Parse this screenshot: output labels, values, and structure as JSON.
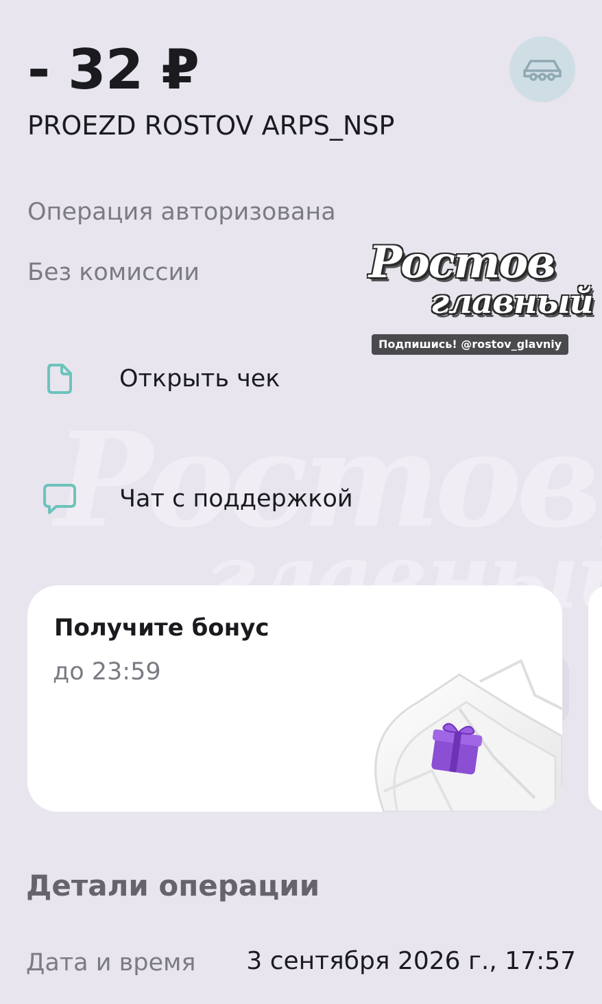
{
  "transaction": {
    "amount": "- 32 ₽",
    "merchant": "PROEZD ROSTOV ARPS_NSP",
    "status": "Операция авторизована",
    "fee": "Без комиссии",
    "category_icon": "car-icon"
  },
  "actions": {
    "receipt_label": "Открыть чек",
    "receipt_icon": "document-icon",
    "chat_label": "Чат с поддержкой",
    "chat_icon": "chat-bubble-icon"
  },
  "bonus": {
    "title": "Получите бонус",
    "until": "до 23:59",
    "art_icon": "gift-icon"
  },
  "details": {
    "section_title": "Детали операции",
    "datetime_label": "Дата и время",
    "datetime_value": "3 сентября 2026 г., 17:57"
  },
  "watermark": {
    "line1": "Ростов",
    "line2": "главный",
    "sub": "Подпишись! @rostov_glavniy",
    "faint_handle": "@rostov_glavniy"
  },
  "colors": {
    "background": "#e8e5ee",
    "accent_teal": "#6cc3bb",
    "category_bg": "#cfdee4",
    "gift_purple": "#8b4fd4"
  }
}
